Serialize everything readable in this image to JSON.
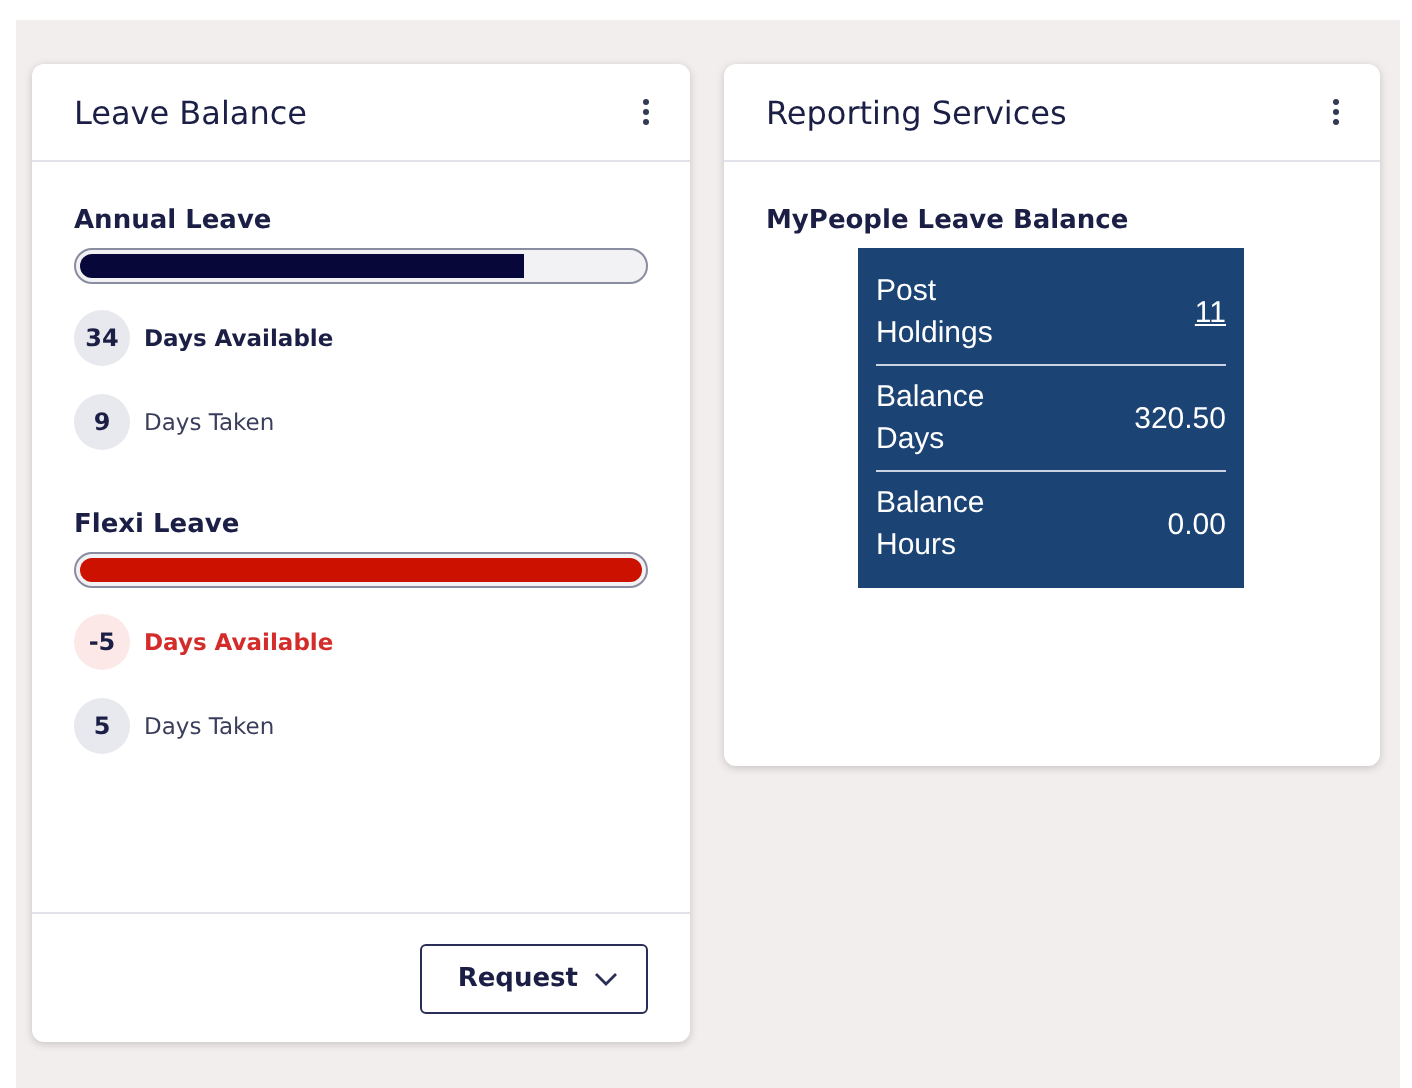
{
  "leave_card": {
    "title": "Leave Balance",
    "leaves": [
      {
        "name": "Annual Leave",
        "level": 0.79,
        "negative": false,
        "stats": [
          {
            "kind": "available",
            "value": "34",
            "label": "Days Available"
          },
          {
            "kind": "taken",
            "value": "9",
            "label": "Days Taken"
          }
        ]
      },
      {
        "name": "Flexi Leave",
        "level": 1,
        "negative": true,
        "stats": [
          {
            "kind": "available",
            "value": "-5",
            "label": "Days Available"
          },
          {
            "kind": "taken",
            "value": "5",
            "label": "Days Taken"
          }
        ]
      }
    ],
    "request_button": "Request"
  },
  "reporting_card": {
    "title": "Reporting Services",
    "subtitle": "MyPeople Leave Balance",
    "rows": [
      {
        "label": "Post Holdings",
        "value": "11",
        "link": true
      },
      {
        "label": "Balance Days",
        "value": "320.50",
        "link": false
      },
      {
        "label": "Balance Hours",
        "value": "0.00",
        "link": false
      }
    ]
  }
}
